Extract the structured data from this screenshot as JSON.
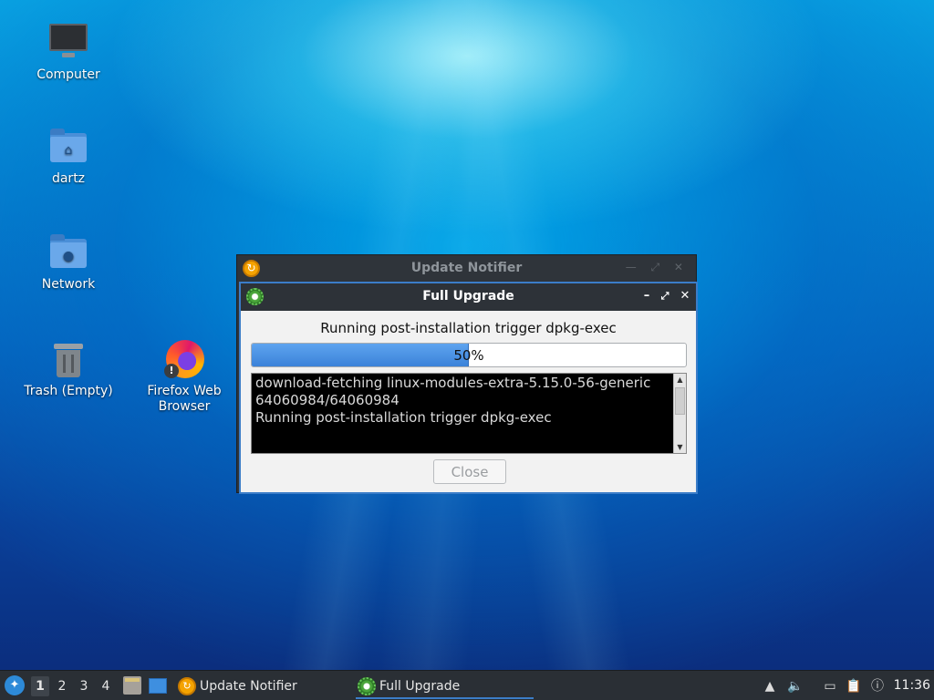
{
  "desktop": {
    "icons": [
      {
        "label": "Computer"
      },
      {
        "label": "dartz"
      },
      {
        "label": "Network"
      },
      {
        "label": "Trash (Empty)"
      },
      {
        "label": "Firefox Web Browser"
      }
    ]
  },
  "background_window": {
    "title": "Update Notifier"
  },
  "dialog": {
    "title": "Full Upgrade",
    "status": "Running post-installation trigger dpkg-exec",
    "progress": {
      "percent": 50,
      "label": "50%"
    },
    "terminal_text": "download-fetching linux-modules-extra-5.15.0-56-generic\n64060984/64060984\nRunning post-installation trigger dpkg-exec",
    "close_label": "Close"
  },
  "taskbar": {
    "workspaces": [
      "1",
      "2",
      "3",
      "4"
    ],
    "active_workspace": "1",
    "tasks": [
      {
        "label": "Update Notifier"
      },
      {
        "label": "Full Upgrade"
      }
    ],
    "clock": "11:36"
  },
  "colors": {
    "accent": "#3b7dc8",
    "progress_fill": "#3b82d9",
    "titlebar": "#2d3238",
    "taskbar": "#2a2f35"
  }
}
